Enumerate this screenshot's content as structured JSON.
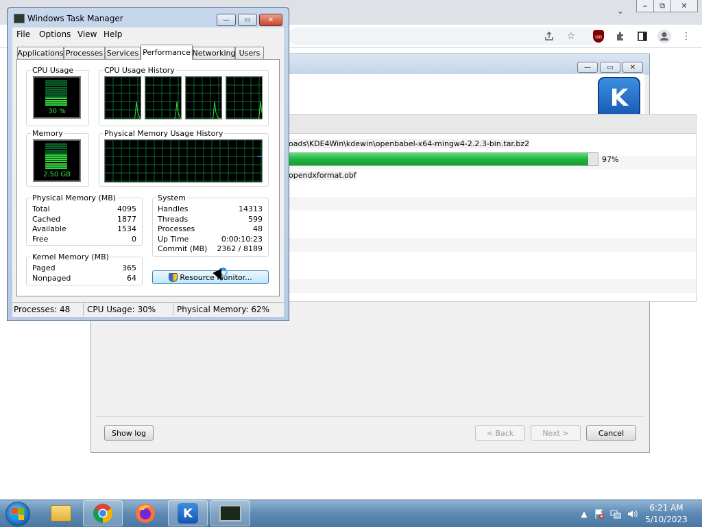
{
  "browser": {
    "window_controls": [
      "⎯",
      "⧉",
      "✕"
    ],
    "dropdown_icon": "chevron-down-icon",
    "toolbar_icons": [
      "share-icon",
      "bookmark-star-icon",
      "ublock-icon",
      "extensions-icon",
      "side-panel-icon",
      "profile-icon",
      "more-menu-icon"
    ],
    "ublock_label": "uo"
  },
  "kde_installer": {
    "window_controls": [
      "—",
      "▭",
      "✕"
    ],
    "logo_letter": "K",
    "download_path": "oads\\KDE4Win\\kdewin\\openbabel-x64-mingw4-2.2.3-bin.tar.bz2",
    "progress_percent": 97,
    "progress_label": "97%",
    "current_file": "opendxformat.obf",
    "buttons": {
      "show_log": "Show log",
      "back": "< Back",
      "next": "Next >",
      "cancel": "Cancel"
    }
  },
  "task_manager": {
    "title": "Windows Task Manager",
    "caption_buttons": [
      "—",
      "▭",
      "✕"
    ],
    "menu": [
      "File",
      "Options",
      "View",
      "Help"
    ],
    "tabs": [
      "Applications",
      "Processes",
      "Services",
      "Performance",
      "Networking",
      "Users"
    ],
    "active_tab": "Performance",
    "cpu_usage": {
      "label": "CPU Usage",
      "value": "30 %",
      "percent": 30
    },
    "cpu_history": {
      "label": "CPU Usage History",
      "cores": 4
    },
    "memory": {
      "label": "Memory",
      "value": "2.50 GB",
      "percent": 62
    },
    "memory_history": {
      "label": "Physical Memory Usage History"
    },
    "physical_memory": {
      "title": "Physical Memory (MB)",
      "rows": [
        {
          "label": "Total",
          "value": "4095"
        },
        {
          "label": "Cached",
          "value": "1877"
        },
        {
          "label": "Available",
          "value": "1534"
        },
        {
          "label": "Free",
          "value": "0"
        }
      ]
    },
    "kernel_memory": {
      "title": "Kernel Memory (MB)",
      "rows": [
        {
          "label": "Paged",
          "value": "365"
        },
        {
          "label": "Nonpaged",
          "value": "64"
        }
      ]
    },
    "system": {
      "title": "System",
      "rows": [
        {
          "label": "Handles",
          "value": "14313"
        },
        {
          "label": "Threads",
          "value": "599"
        },
        {
          "label": "Processes",
          "value": "48"
        },
        {
          "label": "Up Time",
          "value": "0:00:10:23"
        },
        {
          "label": "Commit (MB)",
          "value": "2362 / 8189"
        }
      ]
    },
    "resource_monitor_button": "Resource Monitor...",
    "status_bar": {
      "processes": "Processes: 48",
      "cpu_usage": "CPU Usage: 30%",
      "physical_memory": "Physical Memory: 62%"
    }
  },
  "taskbar": {
    "apps": [
      {
        "name": "windows-explorer",
        "icon": "folder-icon",
        "open": false
      },
      {
        "name": "google-chrome",
        "icon": "chrome-icon",
        "open": true
      },
      {
        "name": "firefox",
        "icon": "firefox-icon",
        "open": false
      },
      {
        "name": "kde-installer",
        "icon": "kde-icon",
        "open": true
      },
      {
        "name": "task-manager",
        "icon": "task-manager-icon",
        "open": true
      }
    ],
    "tray": {
      "show_hidden_icon": "▲",
      "time": "6:21 AM",
      "date": "5/10/2023"
    }
  },
  "colors": {
    "progress_green": "#1fb43e",
    "meter_green": "#38e13f",
    "graph_grid": "#0b6b2e",
    "taskbar_blue": "#5d8ab3"
  }
}
